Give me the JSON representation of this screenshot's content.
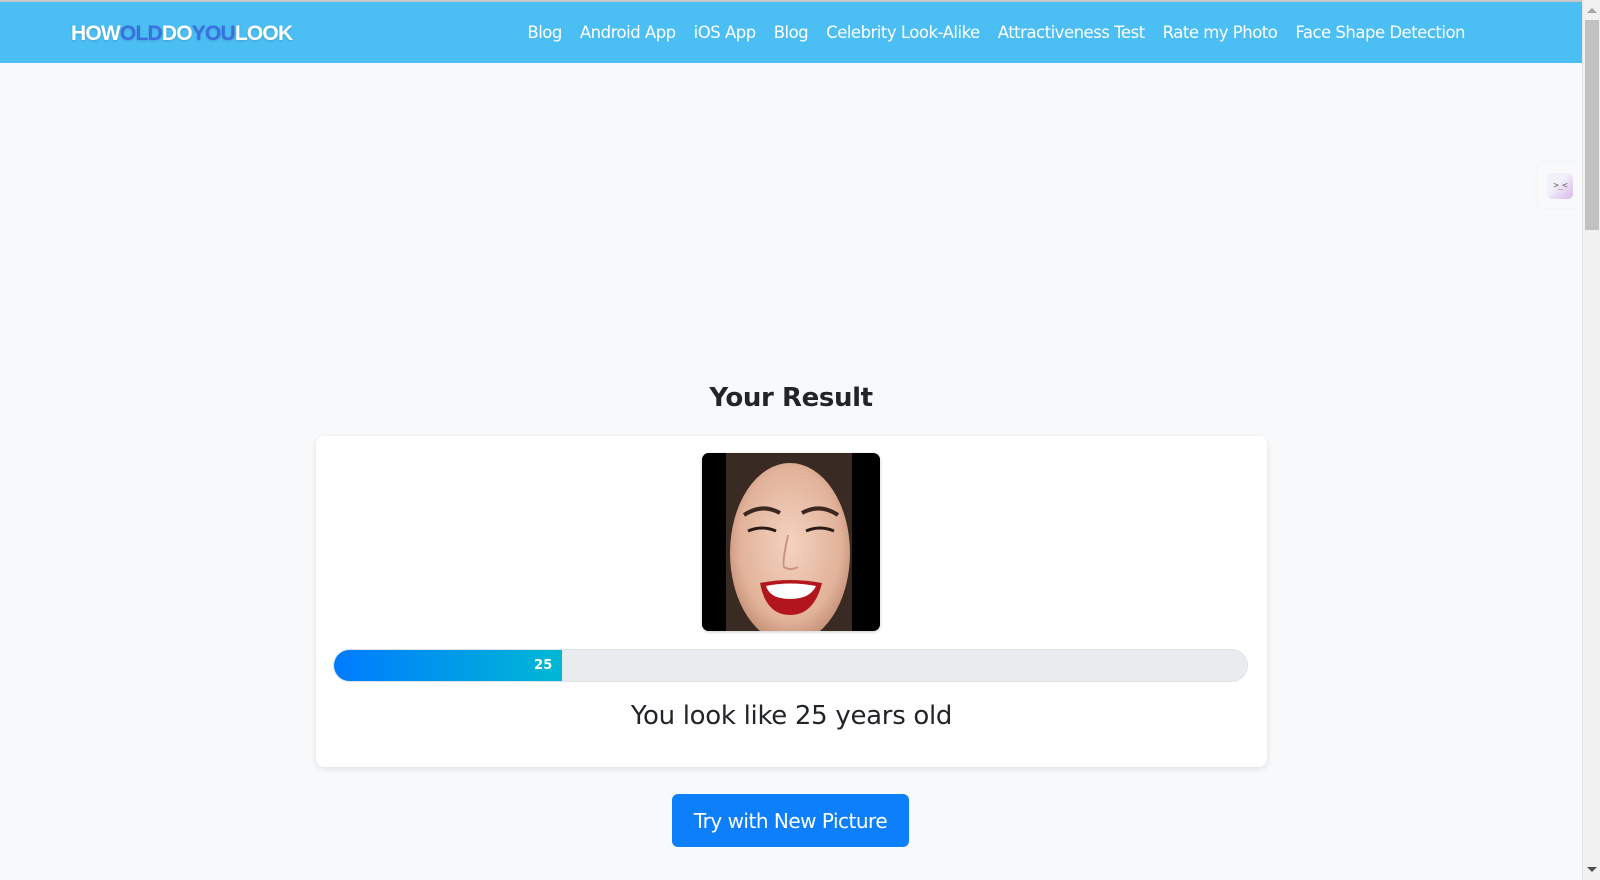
{
  "header": {
    "logo": {
      "parts": [
        {
          "text": "HOW",
          "style": "light"
        },
        {
          "text": "OLD",
          "style": "dark"
        },
        {
          "text": "DO",
          "style": "light"
        },
        {
          "text": "YOU",
          "style": "dark"
        },
        {
          "text": "LOOK",
          "style": "light"
        }
      ]
    },
    "nav": [
      {
        "label": "Blog"
      },
      {
        "label": "Android App"
      },
      {
        "label": "iOS App"
      },
      {
        "label": "Blog"
      },
      {
        "label": "Celebrity Look-Alike"
      },
      {
        "label": "Attractiveness Test"
      },
      {
        "label": "Rate my Photo"
      },
      {
        "label": "Face Shape Detection"
      }
    ],
    "colors": {
      "bar": "#4bbef4",
      "logo_light": "#ffffff",
      "logo_dark": "#3a6fe0"
    }
  },
  "side_widget": {
    "icon": "kaomoji-face-icon",
    "glyph": ">_<"
  },
  "result": {
    "title": "Your Result",
    "photo_alt": "Smiling woman face photo",
    "age": 25,
    "age_max": 100,
    "progress_label": "25",
    "progress_percent": 25,
    "message": "You look like 25 years old"
  },
  "actions": {
    "new_picture_label": "Try with New Picture",
    "accent_color": "#0d7ffb"
  }
}
